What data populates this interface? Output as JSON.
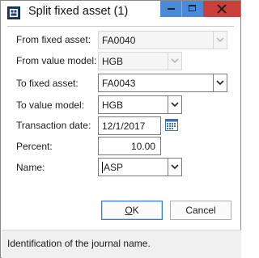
{
  "window": {
    "title": "Split fixed asset (1)"
  },
  "form": {
    "from_fixed_asset": {
      "label": "From fixed asset:",
      "value": "FA0040"
    },
    "from_value_model": {
      "label": "From value model:",
      "value": "HGB"
    },
    "to_fixed_asset": {
      "label": "To fixed asset:",
      "value": "FA0043"
    },
    "to_value_model": {
      "label": "To value model:",
      "value": "HGB"
    },
    "transaction_date": {
      "label": "Transaction date:",
      "value": "12/1/2017"
    },
    "percent": {
      "label": "Percent:",
      "value": "10.00"
    },
    "name": {
      "label": "Name:",
      "value": "ASP"
    }
  },
  "buttons": {
    "ok_mnemonic": "O",
    "ok_rest": "K",
    "cancel": "Cancel"
  },
  "status": {
    "text": "Identification of the journal name."
  },
  "icons": {
    "app": "ax-app-icon",
    "minimize": "minimize-icon",
    "maximize": "maximize-icon",
    "close": "close-icon",
    "dropdown": "chevron-down-icon",
    "calendar": "calendar-icon"
  },
  "colors": {
    "caption_buttons": "#4a8ad6",
    "close_button": "#c7403a",
    "focus_border": "#3a7bd5"
  }
}
